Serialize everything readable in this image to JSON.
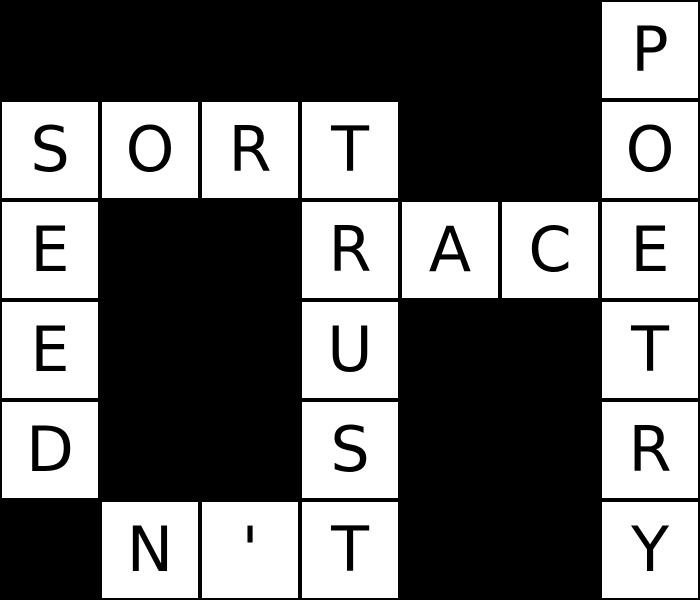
{
  "puzzle": {
    "rows": 6,
    "cols": 7,
    "grid": [
      [
        "#",
        "#",
        "#",
        "#",
        "#",
        "#",
        "P"
      ],
      [
        "S",
        "O",
        "R",
        "T",
        "#",
        "#",
        "O"
      ],
      [
        "E",
        "#",
        "#",
        "R",
        "A",
        "C",
        "E"
      ],
      [
        "E",
        "#",
        "#",
        "U",
        "#",
        "#",
        "T"
      ],
      [
        "D",
        "#",
        "#",
        "S",
        "#",
        "#",
        "R"
      ],
      [
        "#",
        "N",
        "'",
        "T",
        "#",
        "#",
        "Y"
      ]
    ]
  },
  "colors": {
    "block": "#000000",
    "cell": "#ffffff",
    "letter": "#000000"
  }
}
